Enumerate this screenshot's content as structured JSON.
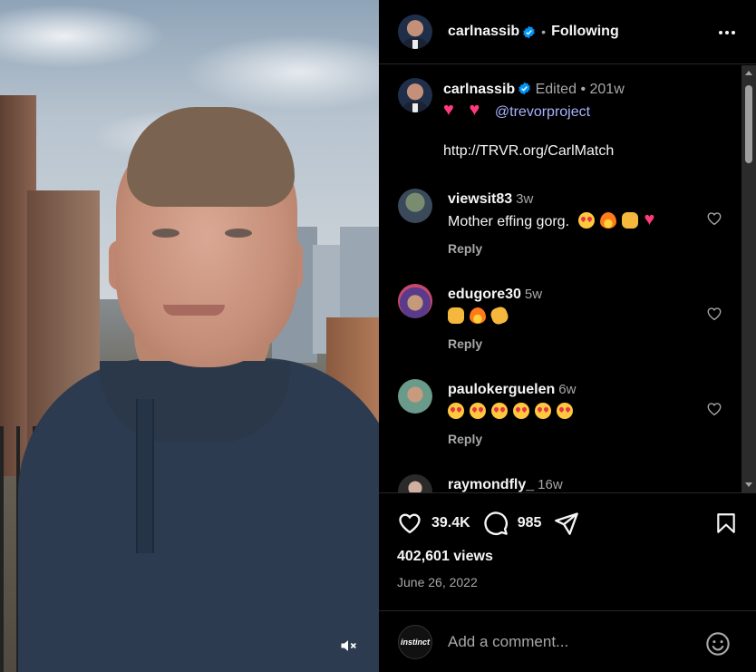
{
  "post": {
    "username": "carlnassib",
    "follow_status": "Following",
    "separator": "•"
  },
  "caption": {
    "username": "carlnassib",
    "edited": "Edited",
    "separator": "•",
    "time": "201w",
    "mention": "@trevorproject",
    "link": "http://TRVR.org/CarlMatch"
  },
  "comments": [
    {
      "username": "viewsit83",
      "time": "3w",
      "text": "Mother effing gorg.",
      "emojis": [
        "heart-eyes",
        "fire",
        "raising-hands",
        "pink-heart"
      ],
      "reply": "Reply"
    },
    {
      "username": "edugore30",
      "time": "5w",
      "text": "",
      "emojis": [
        "raising-hands",
        "fire",
        "clapping-hands"
      ],
      "reply": "Reply"
    },
    {
      "username": "paulokerguelen",
      "time": "6w",
      "text": "",
      "emojis": [
        "heart-eyes",
        "heart-eyes",
        "heart-eyes",
        "heart-eyes",
        "heart-eyes",
        "heart-eyes"
      ],
      "reply": "Reply"
    },
    {
      "username": "raymondfly_",
      "time": "16w"
    }
  ],
  "stats": {
    "likes": "39.4K",
    "comments": "985",
    "views": "402,601 views",
    "date": "June 26, 2022"
  },
  "composer": {
    "avatar_text": "instinct",
    "placeholder": "Add a comment..."
  },
  "icons": {
    "verified": "verified-badge-icon",
    "like": "heart-outline-icon",
    "comment": "speech-bubble-icon",
    "share": "paper-plane-icon",
    "save": "bookmark-icon",
    "mute": "speaker-muted-icon",
    "more": "more-horizontal-icon",
    "emoji": "smiley-icon"
  },
  "colors": {
    "background": "#000000",
    "verified": "#0095f6",
    "mention": "#a8b3ff",
    "muted_text": "#a8a8a8"
  }
}
